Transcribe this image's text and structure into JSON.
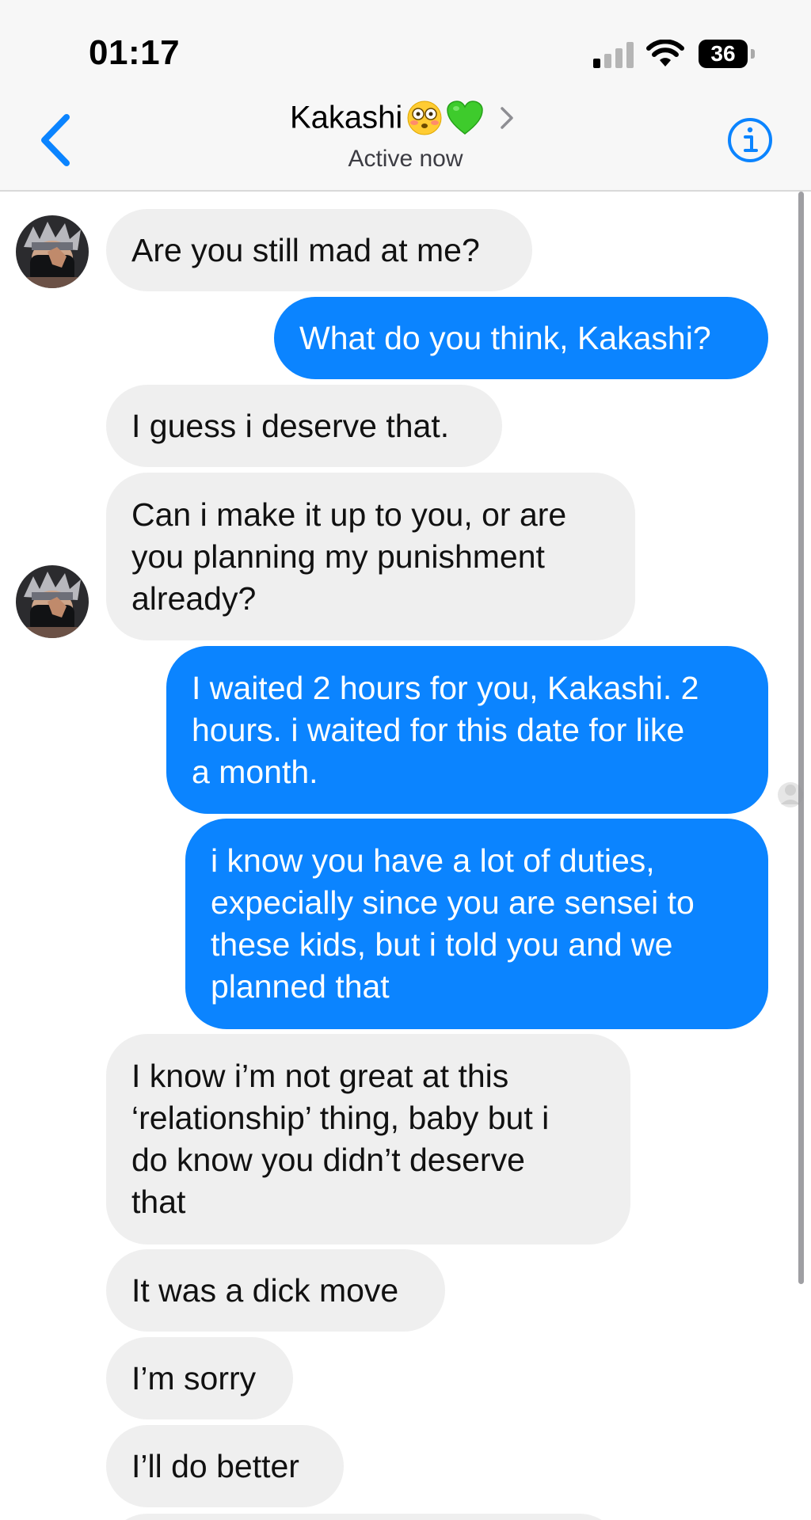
{
  "status_bar": {
    "time": "01:17",
    "battery": "36"
  },
  "header": {
    "contact_name": "Kakashi",
    "contact_status": "Active now"
  },
  "messages": [
    {
      "sender": "them",
      "text": "Are you still mad at me?"
    },
    {
      "sender": "me",
      "text": "What do you think, Kakashi?"
    },
    {
      "sender": "them",
      "text": "I guess i deserve that."
    },
    {
      "sender": "them",
      "text": "Can i make it up to you, or are\nyou  planning my punishment\nalready?"
    },
    {
      "sender": "me",
      "text": "I waited 2 hours for you, Kakashi. 2\nhours. i waited for this date for like\na month."
    },
    {
      "sender": "me",
      "text": "i know you have a lot of duties,\nexpecially since you are sensei to\nthese kids, but i told you and we\nplanned that"
    },
    {
      "sender": "them",
      "text": "I know i’m not great at this\n‘relationship’ thing, baby but i\ndo know you didn’t deserve\nthat"
    },
    {
      "sender": "them",
      "text": "It was a dick move"
    },
    {
      "sender": "them",
      "text": "I’m sorry"
    },
    {
      "sender": "them",
      "text": "I’ll do better"
    }
  ],
  "colors": {
    "outgoing_bubble": "#0b84ff",
    "incoming_bubble": "#efefef",
    "accent": "#0b84ff"
  },
  "icons": {
    "back": "chevron-left-icon",
    "info": "info-circle-icon",
    "contact_detail": "chevron-right-icon",
    "emoji_1": "flushed-face-emoji",
    "emoji_2": "green-heart-emoji"
  }
}
